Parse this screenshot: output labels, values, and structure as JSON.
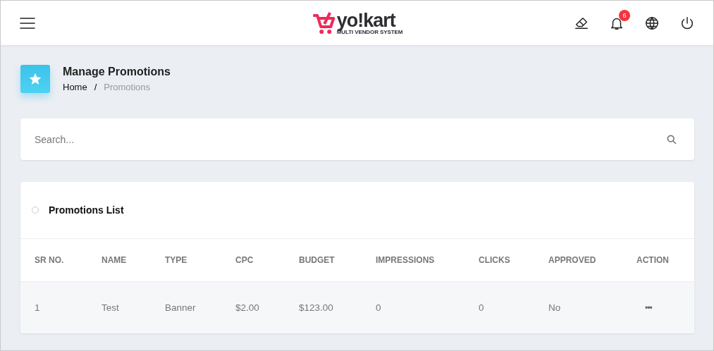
{
  "header": {
    "logo": {
      "wordmark": "yo!kart",
      "tagline": "MULTI VENDOR SYSTEM"
    },
    "notifications": {
      "count": "6"
    }
  },
  "page": {
    "title": "Manage Promotions",
    "breadcrumb": [
      {
        "label": "Home",
        "current": false
      },
      {
        "label": "/",
        "kind": "separator"
      },
      {
        "label": "Promotions",
        "current": true
      }
    ]
  },
  "search": {
    "placeholder": "Search..."
  },
  "table": {
    "title": "Promotions List",
    "columns": [
      "SR NO.",
      "NAME",
      "TYPE",
      "CPC",
      "BUDGET",
      "IMPRESSIONS",
      "CLICKS",
      "APPROVED",
      "ACTION"
    ],
    "rows": [
      {
        "cells": [
          "1",
          "Test",
          "Banner",
          "$2.00",
          "$123.00",
          "0",
          "0",
          "No"
        ],
        "action": "•••"
      }
    ]
  }
}
